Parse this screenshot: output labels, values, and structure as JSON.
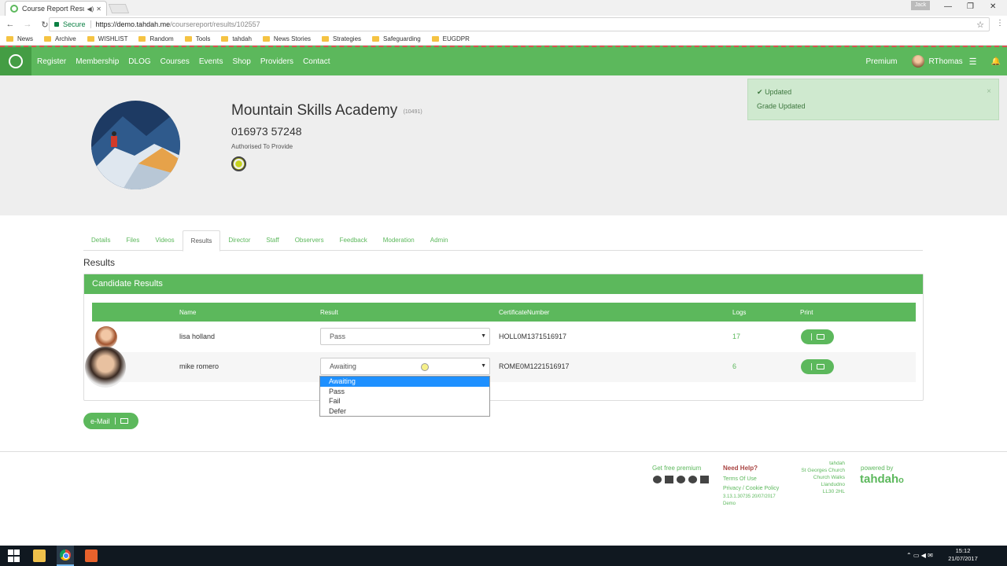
{
  "browser": {
    "tab_title": "Course Report Results",
    "profile_badge": "Jack",
    "secure_label": "Secure",
    "url_host": "https://demo.tahdah.me",
    "url_path": "/coursereport/results/102557",
    "bookmarks": [
      "News",
      "Archive",
      "WISHLIST",
      "Random",
      "Tools",
      "tahdah",
      "News Stories",
      "Strategies",
      "Safeguarding",
      "EUGDPR"
    ]
  },
  "nav": {
    "links": [
      "Register",
      "Membership",
      "DLOG",
      "Courses",
      "Events",
      "Shop",
      "Providers",
      "Contact"
    ],
    "premium": "Premium",
    "username": "RThomas"
  },
  "profile": {
    "name": "Mountain Skills Academy",
    "id": "(10491)",
    "phone": "016973 57248",
    "authorised": "Authorised To Provide"
  },
  "toast": {
    "title": "Updated",
    "message": "Grade Updated",
    "close": "×"
  },
  "tabs": [
    "Details",
    "Files",
    "Videos",
    "Results",
    "Director",
    "Staff",
    "Observers",
    "Feedback",
    "Moderation",
    "Admin"
  ],
  "results": {
    "section_title": "Results",
    "panel_title": "Candidate Results",
    "columns": [
      "Name",
      "Result",
      "CertificateNumber",
      "Logs",
      "Print"
    ],
    "rows": [
      {
        "name": "lisa holland",
        "result": "Pass",
        "certificate": "HOLL0M1371516917",
        "logs": "17"
      },
      {
        "name": "mike romero",
        "result": "Awaiting",
        "certificate": "ROME0M1221516917",
        "logs": "6"
      }
    ],
    "dropdown_options": [
      "Awaiting",
      "Pass",
      "Fail",
      "Defer"
    ],
    "dropdown_selected": "Awaiting",
    "email_button": "e-Mail"
  },
  "footer": {
    "get_premium": "Get free premium",
    "need_help": "Need Help?",
    "terms": "Terms Of Use",
    "privacy": "Privacy / Cookie Policy",
    "version": "3.13.1.30735 20/07/2017",
    "env": "Demo",
    "address": [
      "tahdah",
      "St Georges Church",
      "Church Walks",
      "Llandudno",
      "LL30 2HL"
    ],
    "powered_by": "powered by",
    "brand": "tahdah"
  },
  "taskbar": {
    "time": "15:12",
    "date": "21/07/2017"
  },
  "colors": {
    "brand_green": "#5cb85c",
    "toast_bg": "#cfe9cf",
    "dropdown_highlight": "#1e90ff"
  }
}
